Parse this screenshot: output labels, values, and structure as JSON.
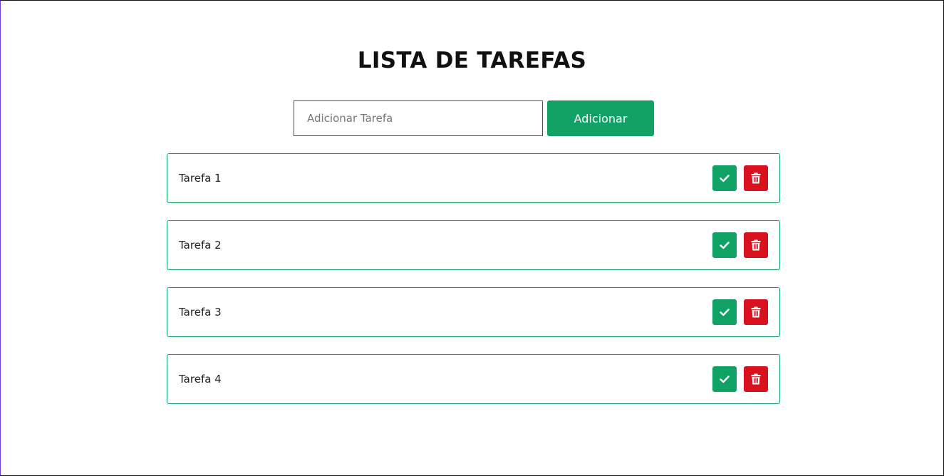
{
  "page": {
    "title": "LISTA DE TAREFAS"
  },
  "form": {
    "input_value": "",
    "input_placeholder": "Adicionar Tarefa",
    "add_label": "Adicionar"
  },
  "tasks": [
    {
      "label": "Tarefa 1",
      "complete_icon": "check-icon",
      "delete_icon": "trash-icon"
    },
    {
      "label": "Tarefa 2",
      "complete_icon": "check-icon",
      "delete_icon": "trash-icon"
    },
    {
      "label": "Tarefa 3",
      "complete_icon": "check-icon",
      "delete_icon": "trash-icon"
    },
    {
      "label": "Tarefa 4",
      "complete_icon": "check-icon",
      "delete_icon": "trash-icon"
    }
  ],
  "colors": {
    "accent_green": "#0fa264",
    "delete_red": "#d9101e",
    "text": "#111111"
  }
}
